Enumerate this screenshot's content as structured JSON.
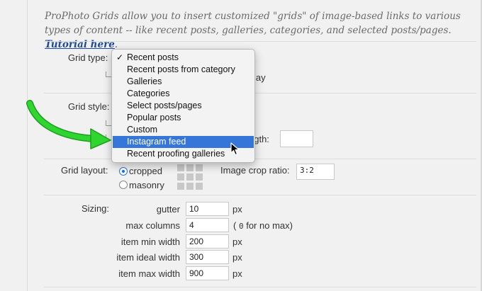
{
  "intro": {
    "text": "ProPhoto Grids allow you to insert customized \"grids\" of image-based links to various types of content -- like recent posts, galleries, categories, and selected posts/pages.",
    "link": "Tutorial here",
    "tail": "."
  },
  "grid_type": {
    "label": "Grid type:",
    "behind_fragment": "lay",
    "options": [
      "Recent posts",
      "Recent posts from category",
      "Galleries",
      "Categories",
      "Select posts/pages",
      "Popular posts",
      "Custom",
      "Instagram feed",
      "Recent proofing galleries"
    ],
    "checked_option": "Recent posts",
    "highlighted_option": "Instagram feed"
  },
  "grid_style": {
    "label": "Grid style:",
    "behind_fragment": "ngth:"
  },
  "grid_layout": {
    "label": "Grid layout:",
    "options": [
      {
        "label": "cropped",
        "selected": true
      },
      {
        "label": "masonry",
        "selected": false
      }
    ],
    "crop_ratio_label": "Image crop ratio:",
    "crop_ratio_value": "3:2"
  },
  "sizing": {
    "label": "Sizing:",
    "rows": [
      {
        "label": "gutter",
        "value": "10",
        "unit": "px"
      },
      {
        "label": "max columns",
        "value": "4",
        "note_prefix": "(",
        "note_code": "0",
        "note_suffix": "for no max)"
      },
      {
        "label": "item min width",
        "value": "200",
        "unit": "px"
      },
      {
        "label": "item ideal width",
        "value": "300",
        "unit": "px"
      },
      {
        "label": "item max width",
        "value": "900",
        "unit": "px"
      }
    ]
  },
  "colors": {
    "highlight": "#3576d8",
    "arrow": "#2fd62f",
    "link": "#1d4a9a"
  }
}
